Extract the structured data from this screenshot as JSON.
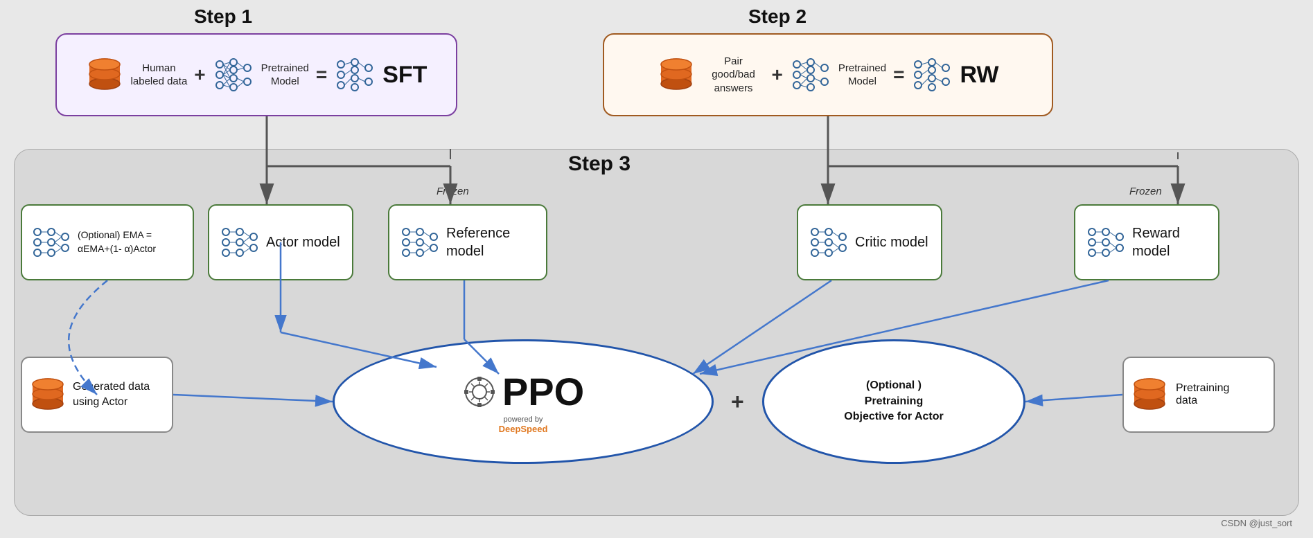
{
  "step1": {
    "label": "Step 1",
    "box": {
      "items": [
        {
          "type": "database",
          "text": "Human\nlabeled data"
        },
        {
          "type": "plus"
        },
        {
          "type": "neural",
          "text": "Pretrained\nModel"
        },
        {
          "type": "equals"
        },
        {
          "type": "neural",
          "text": "SFT"
        }
      ]
    }
  },
  "step2": {
    "label": "Step 2",
    "box": {
      "items": [
        {
          "type": "database",
          "text": "Pair good/bad\nanswers"
        },
        {
          "type": "plus"
        },
        {
          "type": "neural",
          "text": "Pretrained\nModel"
        },
        {
          "type": "equals"
        },
        {
          "type": "neural",
          "text": "RW"
        }
      ]
    }
  },
  "step3": {
    "label": "Step 3",
    "models": {
      "ema": "(Optional) EMA =\nαEMA+(1- α)Actor",
      "actor": "Actor model",
      "reference": "Reference\nmodel",
      "critic": "Critic model",
      "reward": "Reward\nmodel"
    },
    "frozen_labels": [
      "Frozen",
      "Frozen"
    ],
    "ppo": {
      "label": "PPO",
      "powered_by": "powered by",
      "deepspeed": "DeepSpeed"
    },
    "pretraining_objective": {
      "label": "(Optional )\nPretraining\nObjective for Actor"
    },
    "generated_data": "Generated data\nusing Actor",
    "pretraining_data": "Pretraining\ndata"
  },
  "watermark": "CSDN @just_sort"
}
